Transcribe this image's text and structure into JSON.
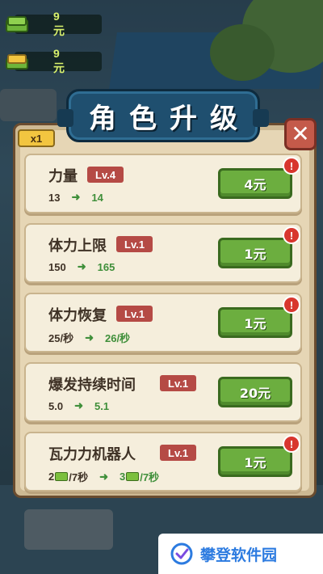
{
  "hud": {
    "money_top": "9元",
    "money_second": "9元"
  },
  "panel": {
    "title": "角色升级",
    "speed_badge": "x1",
    "close_label": "✕"
  },
  "upgrades": [
    {
      "name": "力量",
      "level": "Lv.4",
      "from": "13",
      "to": "14",
      "price": "4元",
      "alert": "!"
    },
    {
      "name": "体力上限",
      "level": "Lv.1",
      "from": "150",
      "to": "165",
      "price": "1元",
      "alert": "!"
    },
    {
      "name": "体力恢复",
      "level": "Lv.1",
      "from": "25/秒",
      "to": "26/秒",
      "price": "1元",
      "alert": "!"
    },
    {
      "name": "爆发持续时间",
      "level": "Lv.1",
      "from": "5.0",
      "to": "5.1",
      "price": "20元"
    },
    {
      "name": "瓦力力机器人",
      "level": "Lv.1",
      "from_count": "2",
      "from_rate": "/7秒",
      "to_count": "3",
      "to_rate": "/7秒",
      "price": "1元",
      "alert": "!"
    }
  ],
  "watermark": {
    "text": "攀登软件园"
  },
  "colors": {
    "buy_button": "#6cae3f",
    "level_badge": "#b54a45",
    "title_banner": "#1f4f6f",
    "close_button": "#c45a4a",
    "arrow": "#3f8f3a"
  }
}
